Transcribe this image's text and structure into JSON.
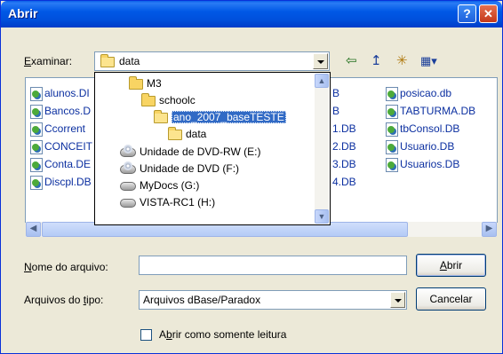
{
  "window": {
    "title": "Abrir",
    "help_glyph": "?",
    "close_glyph": "✕"
  },
  "toolbar": {
    "look_in_label": "Examinar:",
    "look_in_value": "data",
    "back_glyph": "⇦",
    "up_glyph": "↥",
    "new_folder_glyph": "✳",
    "view_glyph": "▦▾"
  },
  "folder_dropdown": [
    {
      "label": "M3",
      "type": "folder",
      "indent": 0
    },
    {
      "label": "schoolc",
      "type": "folder",
      "indent": 1
    },
    {
      "label": "ano_2007_baseTESTE",
      "type": "folder-open",
      "indent": 2,
      "selected": true
    },
    {
      "label": "data",
      "type": "folder-open",
      "indent": 3
    },
    {
      "label": "Unidade de DVD-RW (E:)",
      "type": "cd",
      "indent": 0
    },
    {
      "label": "Unidade de DVD (F:)",
      "type": "cd",
      "indent": 0
    },
    {
      "label": "MyDocs (G:)",
      "type": "drive",
      "indent": 0
    },
    {
      "label": "VISTA-RC1 (H:)",
      "type": "drive",
      "indent": 0
    }
  ],
  "files": {
    "col1": [
      "alunos.DI",
      "Bancos.D",
      "Ccorrent",
      "CONCEIT",
      "Conta.DE",
      "Discpl.DB"
    ],
    "col2": [
      "B",
      "B",
      "1.DB",
      "2.DB",
      "3.DB",
      "4.DB"
    ],
    "col3": [
      "posicao.db",
      "TABTURMA.DB",
      "tbConsol.DB",
      "Usuario.DB",
      "Usuarios.DB"
    ]
  },
  "filename": {
    "label_pre": "",
    "label_u": "N",
    "label_post": "ome do arquivo:",
    "value": ""
  },
  "filetype": {
    "label_pre": "Arquivos do ",
    "label_u": "t",
    "label_post": "ipo:",
    "value": "Arquivos dBase/Paradox"
  },
  "buttons": {
    "open_u": "A",
    "open_rest": "brir",
    "cancel": "Cancelar"
  },
  "readonly": {
    "label_pre": "A",
    "label_u": "b",
    "label_post": "rir como somente leitura",
    "checked": false
  }
}
